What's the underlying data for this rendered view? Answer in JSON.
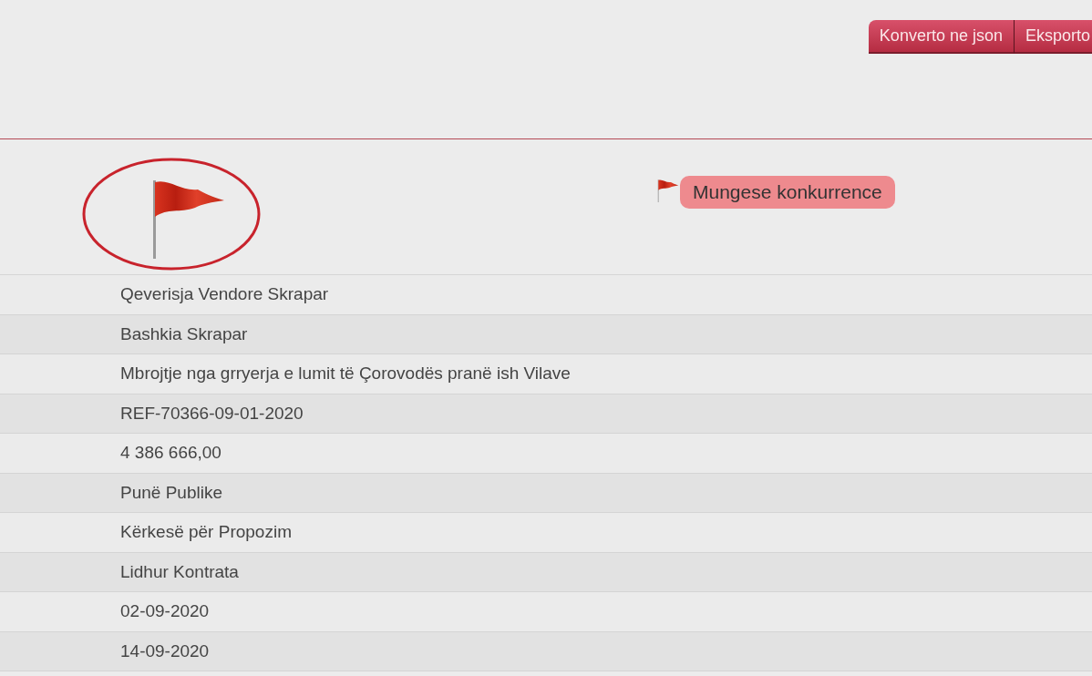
{
  "toolbar": {
    "buttons": [
      "Konverto ne json",
      "Eksporto"
    ]
  },
  "flag_badge": {
    "label": "Mungese konkurrence"
  },
  "rows": [
    "Qeverisja Vendore Skrapar",
    "Bashkia Skrapar",
    "Mbrojtje nga grryerja e lumit të Çorovodës pranë ish Vilave",
    "REF-70366-09-01-2020",
    "4 386 666,00",
    "Punë Publike",
    "Kërkesë për Propozim",
    "Lidhur Kontrata",
    "02-09-2020",
    "14-09-2020"
  ]
}
